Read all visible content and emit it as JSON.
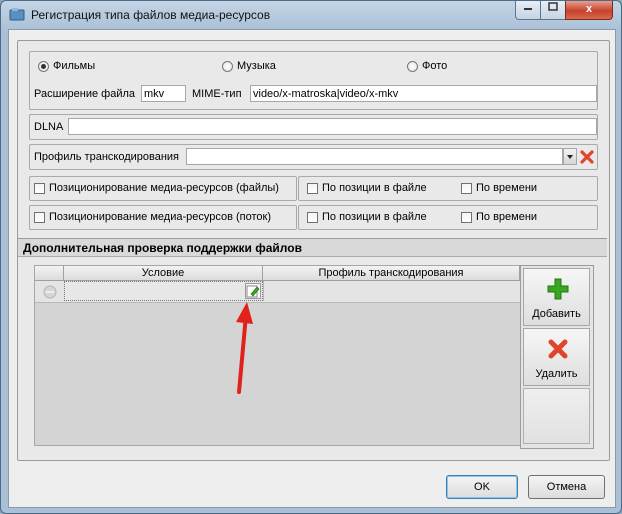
{
  "window": {
    "title": "Регистрация типа файлов медиа-ресурсов",
    "close_glyph": "x"
  },
  "media_type": {
    "options": [
      "Фильмы",
      "Музыка",
      "Фото"
    ],
    "selected": "Фильмы"
  },
  "extension": {
    "label": "Расширение файла",
    "value": "mkv"
  },
  "mime": {
    "label": "MIME-тип",
    "value": "video/x-matroska|video/x-mkv"
  },
  "dlna": {
    "label": "DLNA",
    "value": ""
  },
  "transcoding_profile": {
    "label": "Профиль транскодирования",
    "value": ""
  },
  "seek_files": {
    "label": "Позиционирование медиа-ресурсов (файлы)",
    "by_position": "По позиции в файле",
    "by_time": "По времени"
  },
  "seek_stream": {
    "label": "Позиционирование медиа-ресурсов (поток)",
    "by_position": "По позиции в файле",
    "by_time": "По времени"
  },
  "extra_check": {
    "title": "Дополнительная проверка поддержки файлов",
    "columns": [
      "Условие",
      "Профиль транскодирования"
    ],
    "add_label": "Добавить",
    "delete_label": "Удалить"
  },
  "buttons": {
    "ok": "OK",
    "cancel": "Отмена"
  },
  "colors": {
    "add_icon": "#3aa51f",
    "delete_icon": "#e0442a",
    "arrow": "#e0221b"
  }
}
